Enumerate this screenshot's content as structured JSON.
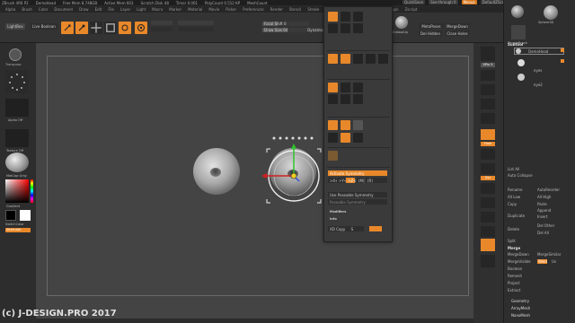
{
  "title_bar": {
    "app": "ZBrush 4R6 P2",
    "document": "DemoHead",
    "free_mem": "Free Mem 8.748GB",
    "active_mem": "Active Mem 603",
    "scratch_disk": "Scratch Disk 48",
    "timer": "Timer 0.001",
    "poly_count": "PolyCount 0.512 KP",
    "mesh_count": "MeshCount",
    "quicksave": "QuickSave",
    "see_through": "See-through 0",
    "menus_btn": "Menus",
    "default_zscript": "DefaultZScript"
  },
  "menu_bar": [
    "Alpha",
    "Brush",
    "Color",
    "Document",
    "Draw",
    "Edit",
    "File",
    "Layer",
    "Light",
    "Macro",
    "Marker",
    "Material",
    "Movie",
    "Picker",
    "Preferences",
    "Render",
    "Stencil",
    "Stroke",
    "Texture",
    "Tool",
    "Transform",
    "Zplugin",
    "Zscript"
  ],
  "menu_active": "Transform",
  "top_shelf": {
    "lightbox": "LightBox",
    "live_boolean": "Live Boolean",
    "focal_shift": "Focal Shift 0",
    "draw_size": "Draw Size 64",
    "dynamic": "Dynamic"
  },
  "left_shelf": {
    "alpha_off": "Alpha Off",
    "texture_off": "Texture Off",
    "material": "MatCap Gray",
    "gradient": "Gradient",
    "switch_color": "SwitchColor",
    "alternate": "Alternate"
  },
  "transform_popup": {
    "activate_symmetry": "Activate Symmetry",
    "x": ">X<",
    "y": ">Y<",
    "z": ">Z<",
    "m": "(M)",
    "r": "(R)",
    "use_poseable_symmetry": "Use Poseable Symmetry",
    "poseable_symmetry": "Poseable Symmetry",
    "modifiers": "Modifiers",
    "info": "Info",
    "xd_copy": "XD Copy",
    "xd_value": "S",
    "spotlight": "Spotlight",
    "rotate": "Rotate",
    "scale": "Scale",
    "move": "Move"
  },
  "under_popup": {
    "deleteheads": "MetaPoses",
    "mergedown": "MergeDown",
    "del_hidden": "Del Hidden",
    "close_holes": "Close Holes",
    "crease_up": "CreaseUp"
  },
  "right_shelf": {
    "spix": "SPix 3",
    "floor": "Floor",
    "local": "Local",
    "xyz": "Xyz"
  },
  "tray": {
    "spheres": "Sphere3D",
    "simple_brush": "SimpleBrush",
    "subtool": "Subtool",
    "demo_head": "DemoHead",
    "eyes": "eyes",
    "eye2": "eye2",
    "list_all": "List All",
    "auto_collapse": "Auto Collapse",
    "rename": "Rename",
    "auto_reorder": "AutoReorder",
    "all_low": "All Low",
    "all_high": "All High",
    "copy": "Copy",
    "paste": "Paste",
    "append": "Append",
    "duplicate": "Duplicate",
    "insert": "Insert",
    "delete": "Delete",
    "del_other": "Del Other",
    "del_all": "Del All",
    "split": "Split",
    "merge": "Merge",
    "merge_down": "MergeDown",
    "merge_similar": "MergeSimilar",
    "merge_visible": "MergeVisible",
    "weld": "Weld",
    "uv": "Uv",
    "boolean": "Boolean",
    "remesh": "Remesh",
    "project": "Project",
    "extract": "Extract",
    "geometry": "Geometry",
    "array_mesh": "ArrayMesh",
    "nano_mesh": "NanoMesh"
  },
  "watermark": "(c) J-DESIGN.PRO  2017",
  "colors": {
    "accent": "#e8882a",
    "canvas": "#444444",
    "panel": "#333333"
  }
}
